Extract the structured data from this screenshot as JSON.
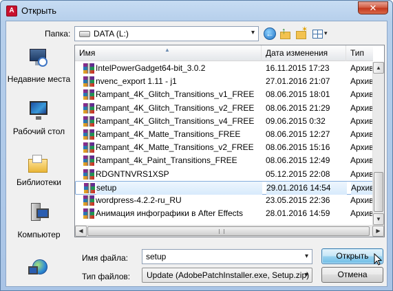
{
  "window": {
    "title": "Открыть",
    "app_icon_letter": "A",
    "close_glyph": "✕"
  },
  "toolbar": {
    "look_in_label": "Папка:",
    "look_in_value": "DATA (L:)",
    "back_glyph": "←",
    "up_glyph": "↑",
    "new_folder_glyph": "✶",
    "dropdown_glyph": "▾"
  },
  "places": [
    {
      "label": "Недавние места",
      "icon": "recent-places-icon"
    },
    {
      "label": "Рабочий стол",
      "icon": "desktop-icon"
    },
    {
      "label": "Библиотеки",
      "icon": "libraries-icon"
    },
    {
      "label": "Компьютер",
      "icon": "computer-icon"
    },
    {
      "label": "",
      "icon": "network-icon"
    }
  ],
  "columns": {
    "name": "Имя",
    "date": "Дата изменения",
    "type": "Тип"
  },
  "files": [
    {
      "name": "IntelPowerGadget64-bit_3.0.2",
      "date": "16.11.2015 17:23",
      "type": "Архив",
      "selected": false
    },
    {
      "name": "nvenc_export 1.11 - j1",
      "date": "27.01.2016 21:07",
      "type": "Архив",
      "selected": false
    },
    {
      "name": "Rampant_4K_Glitch_Transitions_v1_FREE",
      "date": "08.06.2015 18:01",
      "type": "Архив",
      "selected": false
    },
    {
      "name": "Rampant_4K_Glitch_Transitions_v2_FREE",
      "date": "08.06.2015 21:29",
      "type": "Архив",
      "selected": false
    },
    {
      "name": "Rampant_4K_Glitch_Transitions_v4_FREE",
      "date": "09.06.2015 0:32",
      "type": "Архив",
      "selected": false
    },
    {
      "name": "Rampant_4K_Matte_Transitions_FREE",
      "date": "08.06.2015 12:27",
      "type": "Архив",
      "selected": false
    },
    {
      "name": "Rampant_4K_Matte_Transitions_v2_FREE",
      "date": "08.06.2015 15:16",
      "type": "Архив",
      "selected": false
    },
    {
      "name": "Rampant_4k_Paint_Transitions_FREE",
      "date": "08.06.2015 12:49",
      "type": "Архив",
      "selected": false
    },
    {
      "name": "RDGNTNVRS1XSP",
      "date": "05.12.2015 22:08",
      "type": "Архив",
      "selected": false
    },
    {
      "name": "setup",
      "date": "29.01.2016 14:54",
      "type": "Архив",
      "selected": true
    },
    {
      "name": "wordpress-4.2.2-ru_RU",
      "date": "23.05.2015 22:36",
      "type": "Архив",
      "selected": false
    },
    {
      "name": "Анимация инфографики в After Effects",
      "date": "28.01.2016 14:59",
      "type": "Архив",
      "selected": false
    }
  ],
  "filename": {
    "label": "Имя файла:",
    "value": "setup",
    "dropdown_glyph": "▾"
  },
  "filetype": {
    "label": "Тип файлов:",
    "value": "Update (AdobePatchInstaller.exe, Setup.zip)",
    "dropdown_glyph": "▾"
  },
  "buttons": {
    "open": "Открыть",
    "cancel": "Отмена"
  },
  "scroll_glyphs": {
    "up": "▲",
    "down": "▼",
    "left": "◀",
    "right": "▶",
    "sort": "▲"
  }
}
